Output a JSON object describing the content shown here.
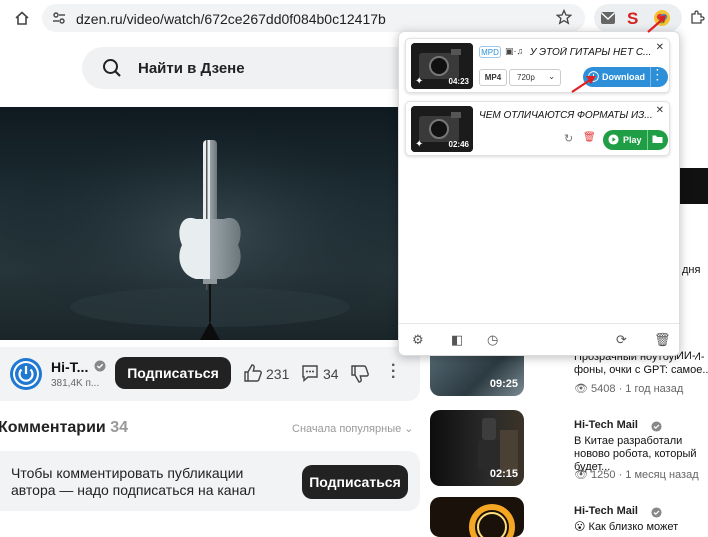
{
  "browser": {
    "url": "dzen.ru/video/watch/672ce267dd0f084b0c12417b"
  },
  "site": {
    "search_placeholder": "Найти в Дзене"
  },
  "channel": {
    "name": "Hi-T...",
    "subscribers": "381,4K п...",
    "subscribe_label": "Подписаться",
    "likes": "231",
    "comments": "34"
  },
  "comments": {
    "title": "Комментарии",
    "count": "34",
    "sort_label": "Сначала популярные",
    "prompt": "Чтобы комментировать публикации автора — надо подписаться на канал",
    "subscribe_label": "Подписаться"
  },
  "recommendations": [
    {
      "title": "Прозрачный ноутбук, ИИ-фоны, очки с GPT: самое...",
      "duration": "09:25",
      "views": "5408",
      "ago": "1 год назад"
    },
    {
      "channel": "Hi-Tech Mail",
      "title": "В Китае разработали новово робота, который будет...",
      "duration": "02:15",
      "views": "1250",
      "ago": "1 месяц назад"
    },
    {
      "channel": "Hi-Tech Mail",
      "title": "Как близко может"
    }
  ],
  "extension": {
    "items": [
      {
        "badge": "MPD",
        "title": "У ЭТОЙ ГИТАРЫ НЕТ С...",
        "duration": "04:23",
        "format": "MP4",
        "quality": "720p",
        "action_label": "Download"
      },
      {
        "title": "ЧЕМ ОТЛИЧАЮТСЯ ФОРМАТЫ ИЗ...",
        "duration": "02:46",
        "action_label": "Play"
      }
    ]
  },
  "right_edge": {
    "text1": "дня",
    "text2": "ИИ-"
  },
  "colors": {
    "accent_blue": "#2d8fd8",
    "accent_green": "#1f9e45",
    "arrow_red": "#e02020"
  }
}
